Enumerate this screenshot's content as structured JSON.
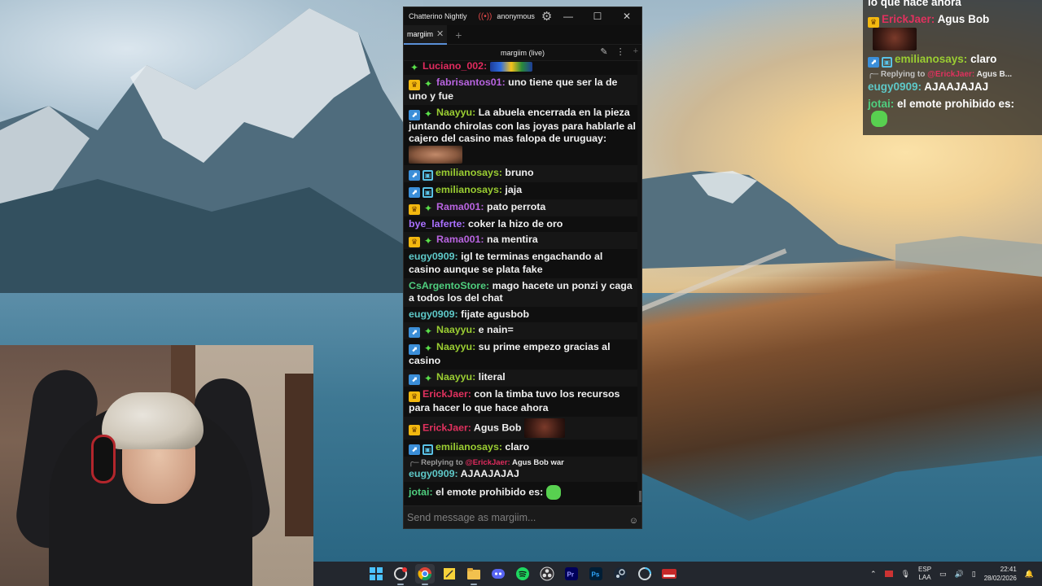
{
  "window": {
    "app_title": "Chatterino Nightly",
    "account": "anonymous",
    "minimize": "—",
    "maximize": "☐",
    "close": "✕"
  },
  "tabs": [
    {
      "label": "margiim"
    }
  ],
  "tab_add": "+",
  "split": {
    "title": "margiim (live)"
  },
  "input": {
    "placeholder": "Send message as margiim..."
  },
  "messages": [
    {
      "name": "Luciano_002:",
      "color": "#e02b5e",
      "text": "",
      "badges": [
        "star"
      ],
      "emote": "wide-colorful"
    },
    {
      "name": "fabrisantos01:",
      "color": "#b864e0",
      "text": "uno tiene que ser la de uno y fue",
      "badges": [
        "crown",
        "star"
      ]
    },
    {
      "name": "Naayyu:",
      "color": "#9acd32",
      "text": "La abuela encerrada en la pieza juntando chirolas con las joyas para hablarle al cajero del casino mas falopa de uruguay:",
      "badges": [
        "drop",
        "star"
      ],
      "emote": "face"
    },
    {
      "name": "emilianosays:",
      "color": "#9acd32",
      "text": "bruno",
      "badges": [
        "drop",
        "glitch"
      ]
    },
    {
      "name": "emilianosays:",
      "color": "#9acd32",
      "text": "jaja",
      "badges": [
        "drop",
        "glitch"
      ]
    },
    {
      "name": "Rama001:",
      "color": "#b864e0",
      "text": "pato perrota",
      "badges": [
        "crown",
        "star"
      ]
    },
    {
      "name": "bye_laferte:",
      "color": "#a970ff",
      "text": "coker la hizo de oro",
      "badges": []
    },
    {
      "name": "Rama001:",
      "color": "#b864e0",
      "text": "na mentira",
      "badges": [
        "crown",
        "star"
      ]
    },
    {
      "name": "eugy0909:",
      "color": "#5ec8c8",
      "text": "igl te terminas engachando al casino aunque se plata fake",
      "badges": []
    },
    {
      "name": "CsArgentoStore:",
      "color": "#4fce7e",
      "text": "mago hacete un ponzi y caga a todos los del chat",
      "badges": []
    },
    {
      "name": "eugy0909:",
      "color": "#5ec8c8",
      "text": "fijate agusbob",
      "badges": []
    },
    {
      "name": "Naayyu:",
      "color": "#9acd32",
      "text": "e nain=",
      "badges": [
        "drop",
        "star"
      ]
    },
    {
      "name": "Naayyu:",
      "color": "#9acd32",
      "text": "su prime empezo gracias al casino",
      "badges": [
        "drop",
        "star"
      ]
    },
    {
      "name": "Naayyu:",
      "color": "#9acd32",
      "text": "literal",
      "badges": [
        "drop",
        "star"
      ]
    },
    {
      "name": "ErickJaer:",
      "color": "#e0315e",
      "text": "con la timba tuvo los recursos para hacer lo que hace ahora",
      "badges": [
        "crown"
      ]
    },
    {
      "name": "ErickJaer:",
      "color": "#e0315e",
      "text": "Agus Bob",
      "badges": [
        "crown"
      ],
      "emote": "dark-face"
    },
    {
      "name": "emilianosays:",
      "color": "#9acd32",
      "text": "claro",
      "badges": [
        "drop",
        "glitch"
      ]
    },
    {
      "name": "eugy0909:",
      "color": "#5ec8c8",
      "text": "AJAAJAJAJ",
      "badges": [],
      "reply": {
        "prefix": "Replying to",
        "to": "@ErickJaer:",
        "text": "Agus Bob war"
      }
    },
    {
      "name": "jotai:",
      "color": "#4fce7e",
      "text": "el emote prohibido es:",
      "badges": [],
      "emote": "green-blob"
    }
  ],
  "overlay": {
    "top_text": "lo que hace ahora",
    "rows": [
      {
        "name": "ErickJaer:",
        "color": "#e0315e",
        "text": "Agus Bob",
        "badges": [
          "crown"
        ]
      },
      {
        "name": "emilianosays:",
        "color": "#9acd32",
        "text": "claro",
        "badges": [
          "drop",
          "glitch"
        ]
      },
      {
        "name": "eugy0909:",
        "color": "#5ec8c8",
        "text": "AJAAJAJAJ",
        "reply": {
          "prefix": "Replying to",
          "to": "@ErickJaer:",
          "text": "Agus B..."
        }
      },
      {
        "name": "jotai:",
        "color": "#4fce7e",
        "text": "el emote prohibido es:"
      }
    ]
  },
  "taskbar": {
    "apps": [
      "windows-start-icon",
      "chatterino-icon",
      "chrome-icon",
      "sticky-notes-icon",
      "file-explorer-icon",
      "discord-icon",
      "spotify-icon",
      "obs-icon",
      "premiere-icon",
      "photoshop-icon",
      "steam-icon",
      "browser-icon",
      "video-app-icon"
    ],
    "lang_top": "ESP",
    "lang_bottom": "LAA",
    "time": "22:41",
    "date": "28/02/2026"
  },
  "colors": {
    "accent": "#5a8fd6",
    "window_bg": "#0f0f0f",
    "alt_row": "#161616"
  }
}
